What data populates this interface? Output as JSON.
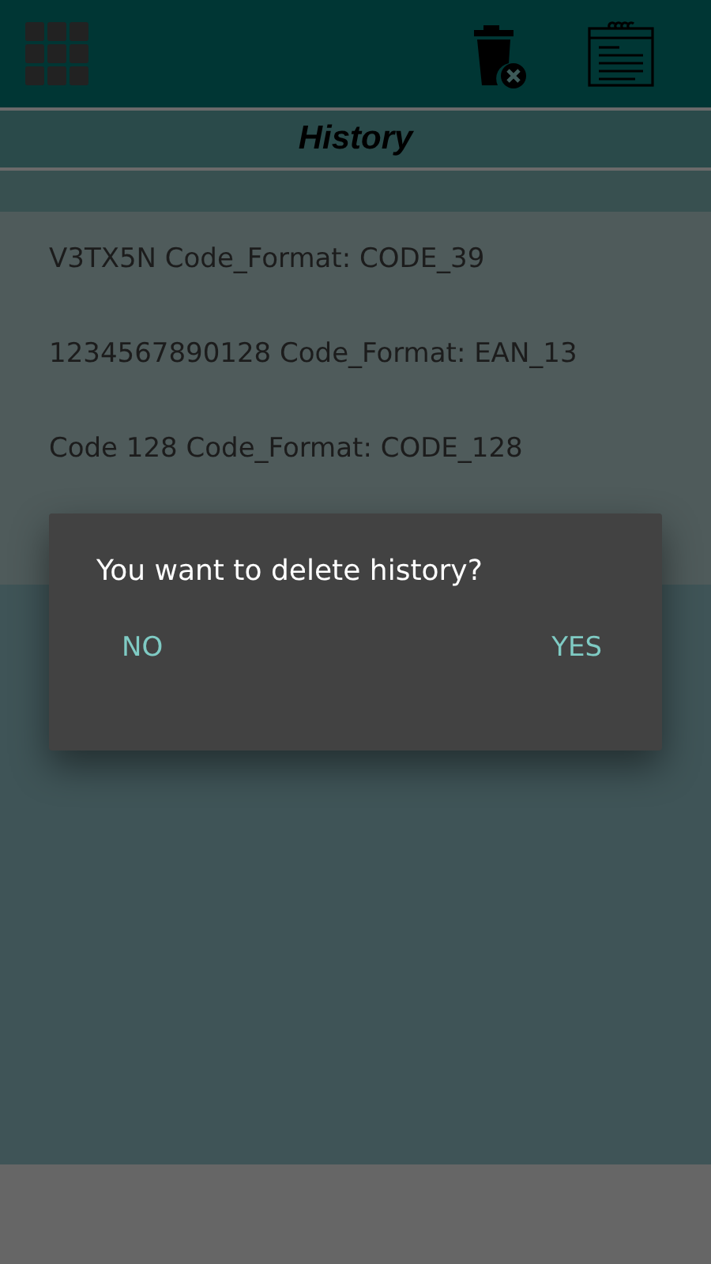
{
  "header": {
    "title": "History"
  },
  "history": [
    {
      "text": "V3TX5N Code_Format: CODE_39"
    },
    {
      "text": "1234567890128 Code_Format: EAN_13"
    },
    {
      "text": "Code 128 Code_Format: CODE_128"
    }
  ],
  "dialog": {
    "message": "You want to delete history?",
    "buttons": [
      "NO",
      "YES"
    ]
  }
}
